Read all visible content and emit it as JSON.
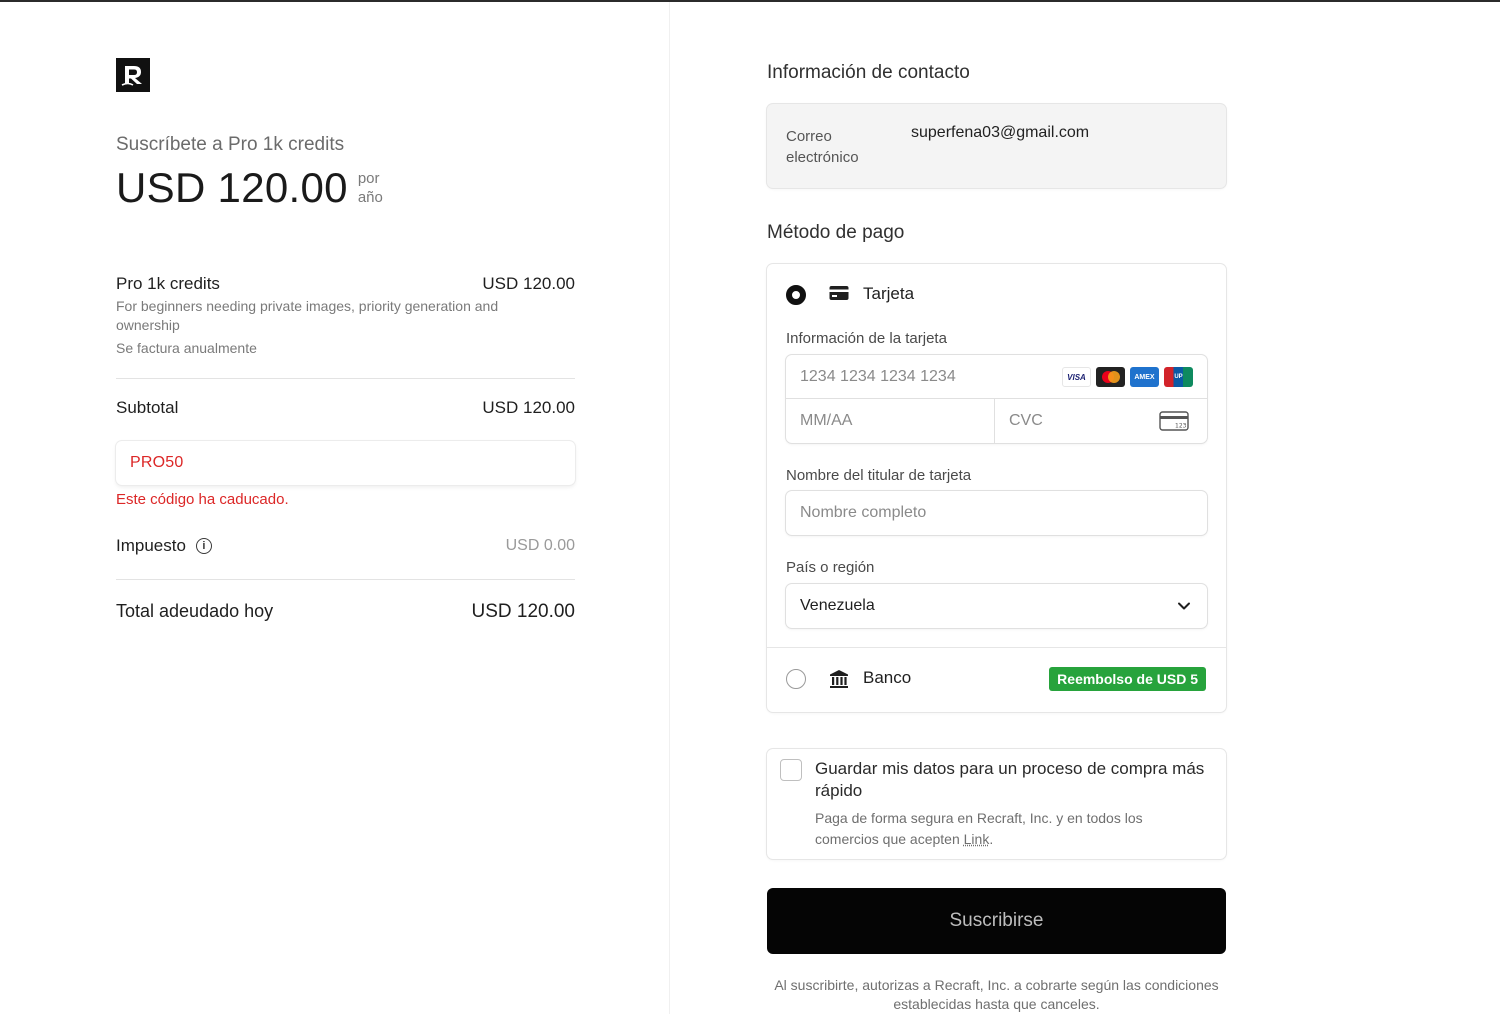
{
  "brand": {
    "logo_icon": "recraft-logo-icon"
  },
  "summary": {
    "subscribe_title": "Suscríbete a Pro 1k credits",
    "price": "USD 120.00",
    "period_line1": "por",
    "period_line2": "año",
    "item": {
      "name": "Pro 1k credits",
      "price": "USD 120.00",
      "description": "For beginners needing private images, priority generation and ownership",
      "billing": "Se factura anualmente"
    },
    "subtotal_label": "Subtotal",
    "subtotal_value": "USD 120.00",
    "promo_code": "PRO50",
    "promo_error": "Este código ha caducado.",
    "tax_label": "Impuesto",
    "tax_value": "USD 0.00",
    "total_label": "Total adeudado hoy",
    "total_value": "USD 120.00"
  },
  "contact": {
    "title": "Información de contacto",
    "email_label": "Correo electrónico",
    "email_value": "superfena03@gmail.com"
  },
  "payment": {
    "title": "Método de pago",
    "card_option": {
      "label": "Tarjeta",
      "selected": true
    },
    "card_info_label": "Información de la tarjeta",
    "card_number_placeholder": "1234 1234 1234 1234",
    "card_brands": [
      "VISA",
      "mastercard",
      "amex",
      "unionpay"
    ],
    "expiry_placeholder": "MM/AA",
    "cvc_placeholder": "CVC",
    "cardholder_label": "Nombre del titular de tarjeta",
    "cardholder_placeholder": "Nombre completo",
    "country_label": "País o región",
    "country_value": "Venezuela",
    "bank_option": {
      "label": "Banco",
      "selected": false
    },
    "bank_badge": "Reembolso de USD 5"
  },
  "save": {
    "title": "Guardar mis datos para un proceso de compra más rápido",
    "desc_prefix": "Paga de forma segura en Recraft, Inc. y en todos los comercios que acepten ",
    "desc_link": "Link",
    "desc_suffix": ".",
    "checked": false
  },
  "subscribe_button": "Suscribirse",
  "legal": "Al suscribirte, autorizas a Recraft, Inc. a cobrarte según las condiciones establecidas hasta que canceles.",
  "colors": {
    "accent": "#050505",
    "error": "#dc2727",
    "badge": "#27a33c"
  }
}
